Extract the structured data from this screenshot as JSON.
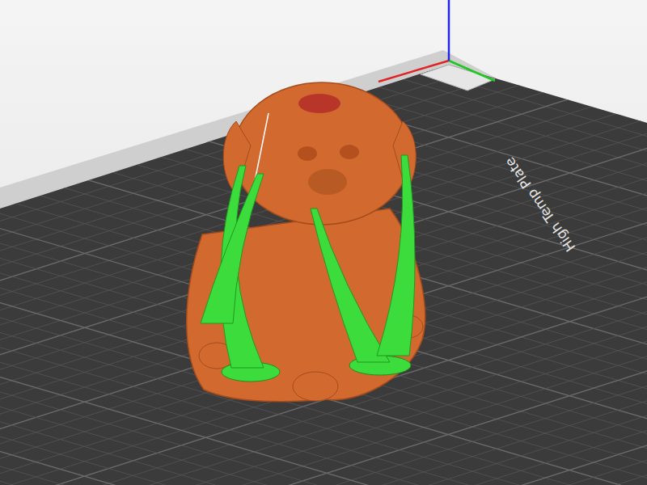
{
  "viewport": {
    "plate_label": "High Temp Plate"
  },
  "axes": [
    {
      "kind": "x",
      "color": "#e02424"
    },
    {
      "kind": "y",
      "color": "#1ec81e"
    },
    {
      "kind": "z",
      "color": "#2424e6"
    }
  ],
  "objects": [
    {
      "kind": "model",
      "color": "#d2692f"
    },
    {
      "kind": "support",
      "color": "#3ddc3d"
    }
  ]
}
